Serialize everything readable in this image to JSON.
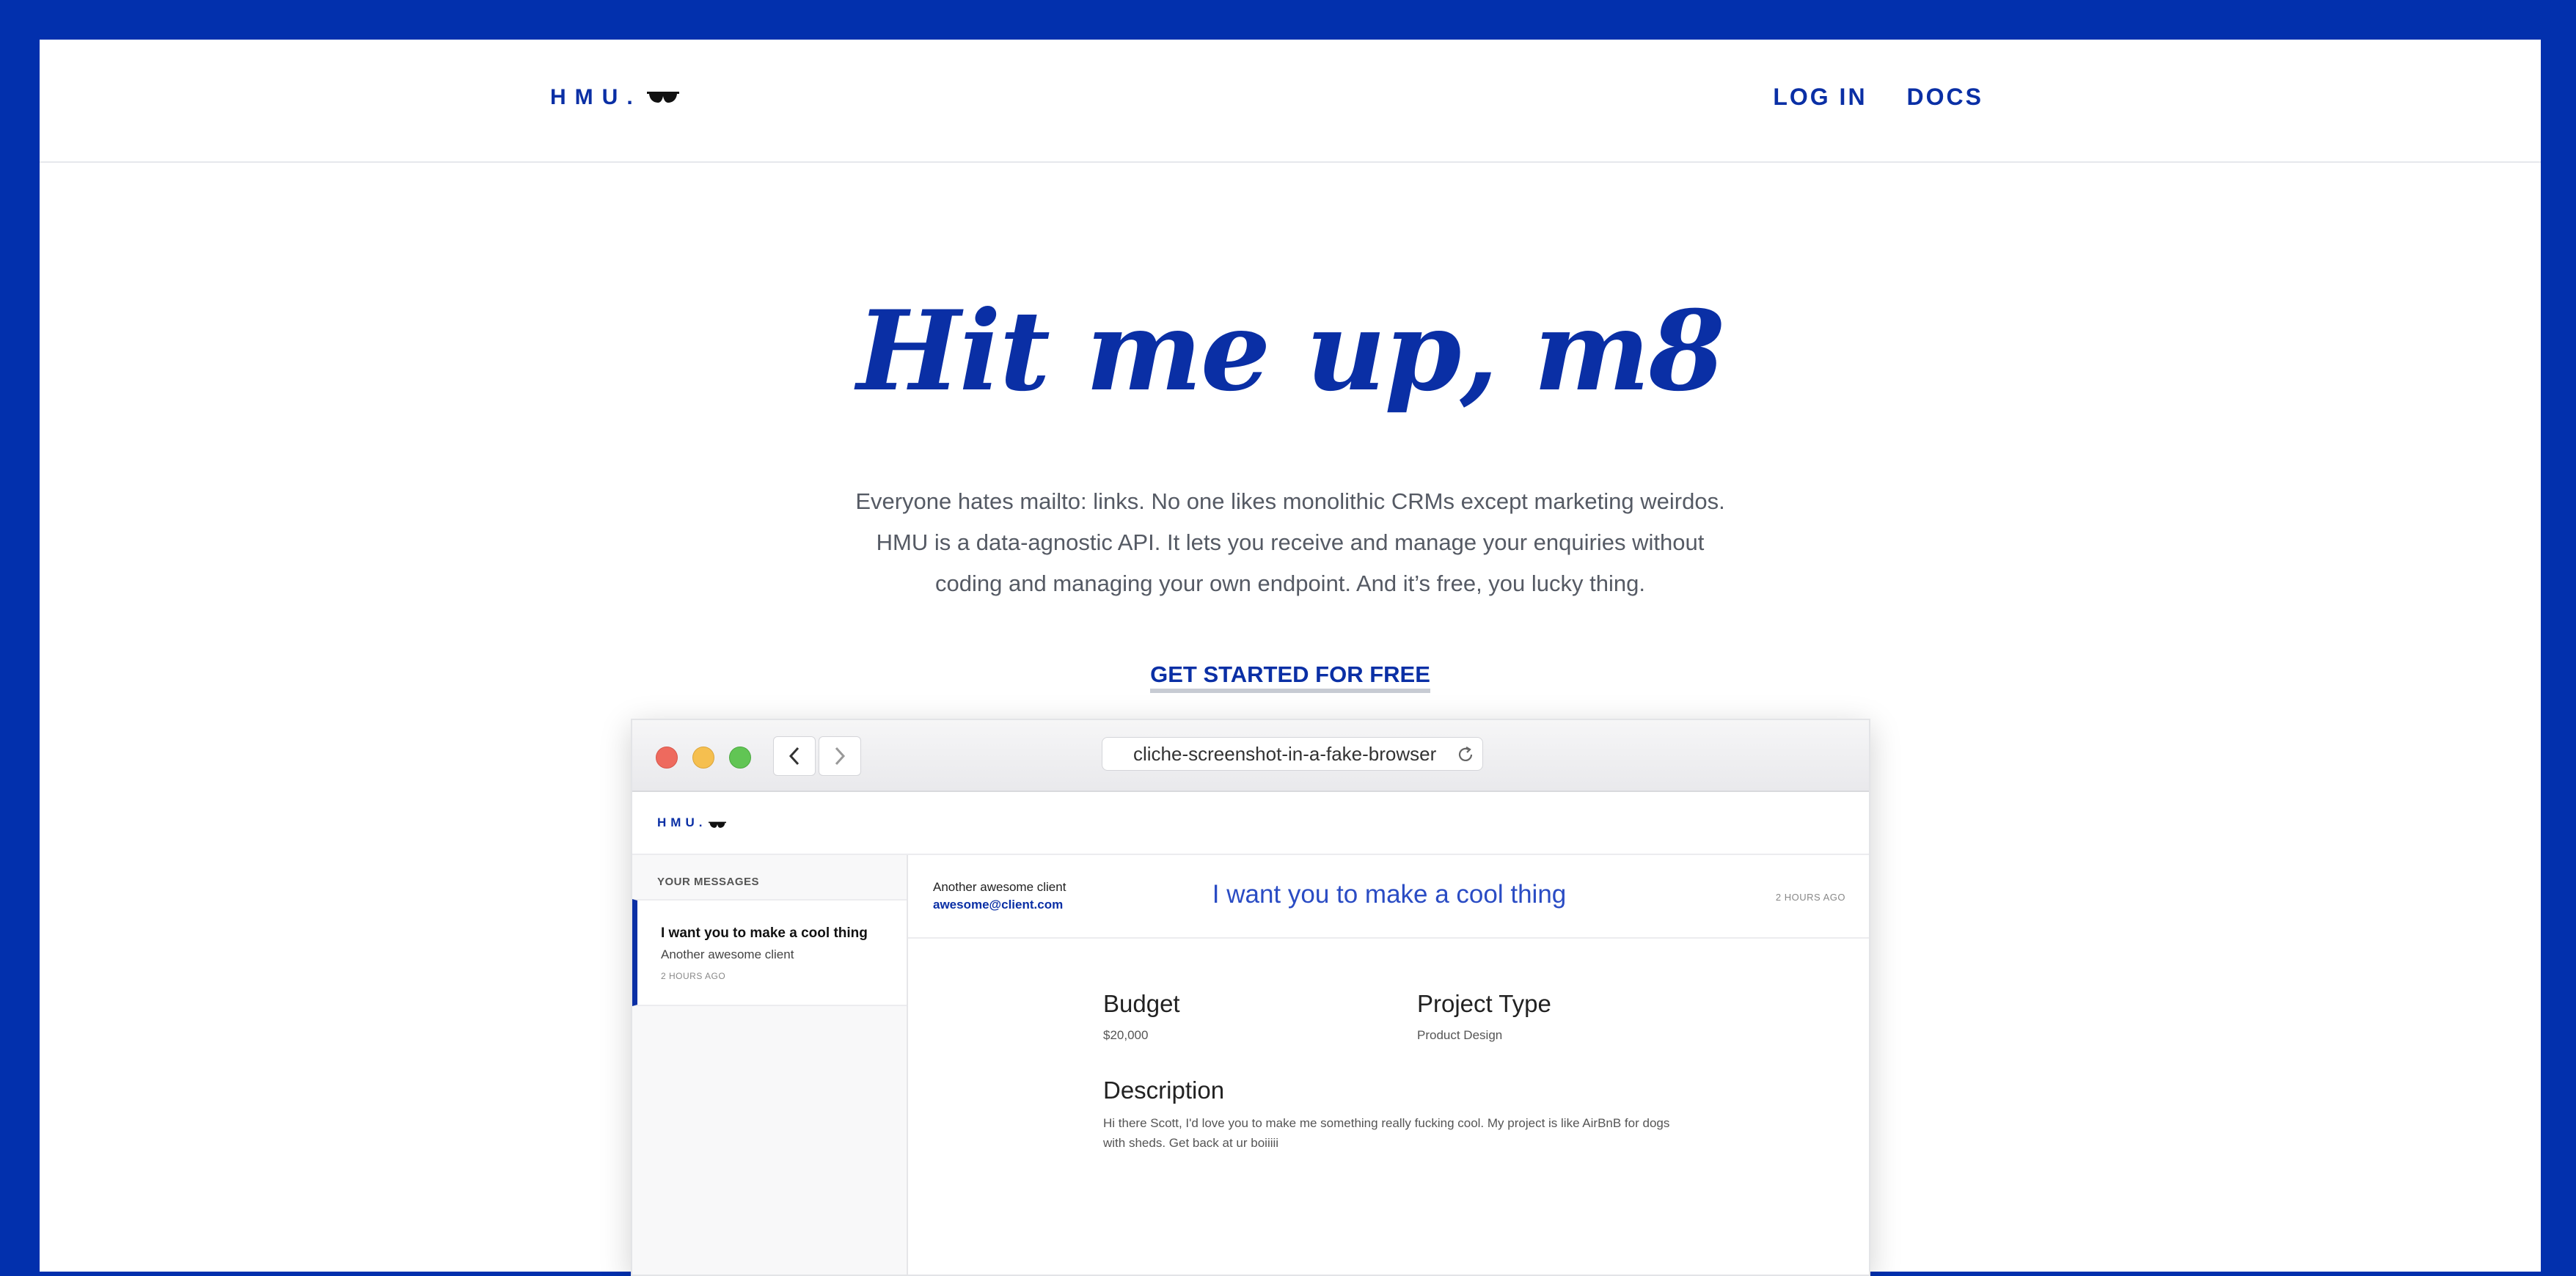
{
  "site": {
    "logo": "HMU.",
    "nav": [
      "LOG IN",
      "DOCS"
    ]
  },
  "hero": {
    "title": "Hit me up, m8",
    "subtitle": "Everyone hates mailto: links. No one likes monolithic CRMs except marketing weirdos. HMU is a data-agnostic API. It lets you receive and manage your enquiries without coding and managing your own endpoint. And it’s free, you lucky thing.",
    "cta": "GET STARTED FOR FREE"
  },
  "browser": {
    "url": "cliche-screenshot-in-a-fake-browser",
    "icons": [
      "back-arrow-icon",
      "forward-arrow-icon",
      "reload-icon"
    ]
  },
  "app": {
    "logo": "HMU.",
    "sidebar_title": "YOUR MESSAGES",
    "messages": [
      {
        "title": "I want you to make a cool thing",
        "from": "Another awesome client",
        "date": "2 HOURS AGO"
      }
    ],
    "detail": {
      "from_name": "Another awesome client",
      "from_email": "awesome@client.com",
      "subject": "I want you to make a cool thing",
      "date": "2 HOURS AGO",
      "budget_label": "Budget",
      "budget_value": "$20,000",
      "project_type_label": "Project Type",
      "project_type_value": "Product Design",
      "description_label": "Description",
      "description_value": "Hi there Scott, I'd love you to make me something really fucking cool. My project is like AirBnB for dogs with sheds. Get back at ur boiiiii"
    }
  },
  "colors": {
    "brand_blue": "#0230ad",
    "text_blue": "#0a2fa5"
  }
}
